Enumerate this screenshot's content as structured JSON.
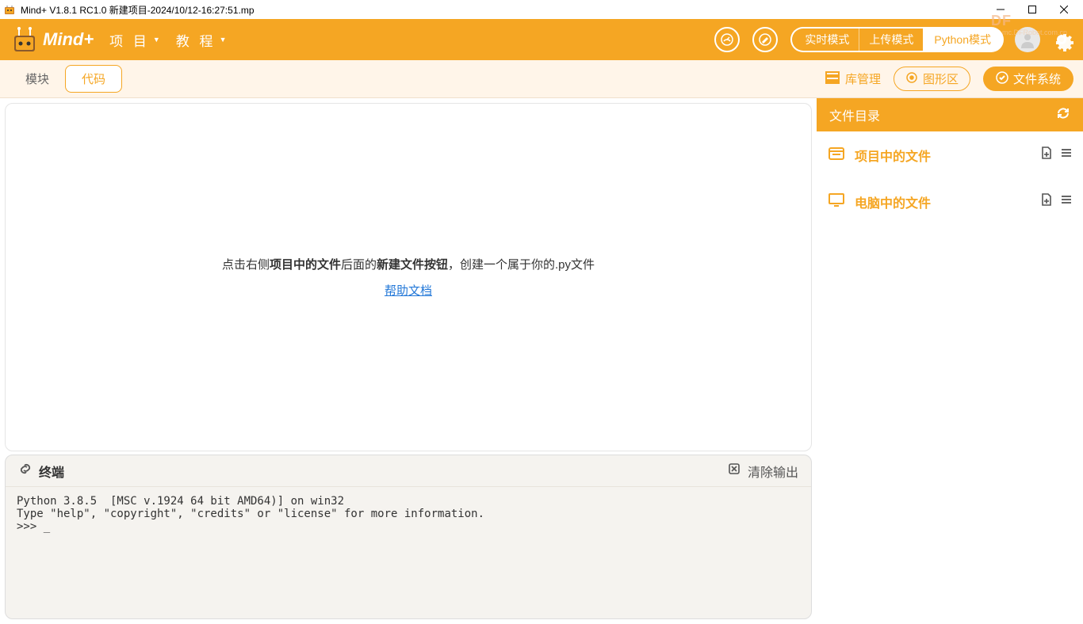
{
  "titlebar": {
    "title": "Mind+ V1.8.1 RC1.0   新建项目-2024/10/12-16:27:51.mp",
    "watermark": "DF",
    "watermark_sub": "mc.DFRobot.com.cn"
  },
  "menubar": {
    "logo_text": "Mind+",
    "project": "项 目",
    "tutorial": "教 程",
    "modes": {
      "realtime": "实时模式",
      "upload": "上传模式",
      "python": "Python模式"
    }
  },
  "toolbar": {
    "tab_module": "模块",
    "tab_code": "代码",
    "lib_manage": "库管理",
    "graphic": "图形区",
    "filesystem": "文件系统"
  },
  "editor": {
    "hint_pre": "点击右侧",
    "hint_b1": "项目中的文件",
    "hint_mid": "后面的",
    "hint_b2": "新建文件按钮",
    "hint_post": "，创建一个属于你的.py文件",
    "help_link": "帮助文档"
  },
  "terminal": {
    "title": "终端",
    "clear": "清除输出",
    "content": "Python 3.8.5  [MSC v.1924 64 bit AMD64)] on win32\nType \"help\", \"copyright\", \"credits\" or \"license\" for more information.\n>>> _"
  },
  "sidebar": {
    "title": "文件目录",
    "group_project": "项目中的文件",
    "group_computer": "电脑中的文件"
  }
}
